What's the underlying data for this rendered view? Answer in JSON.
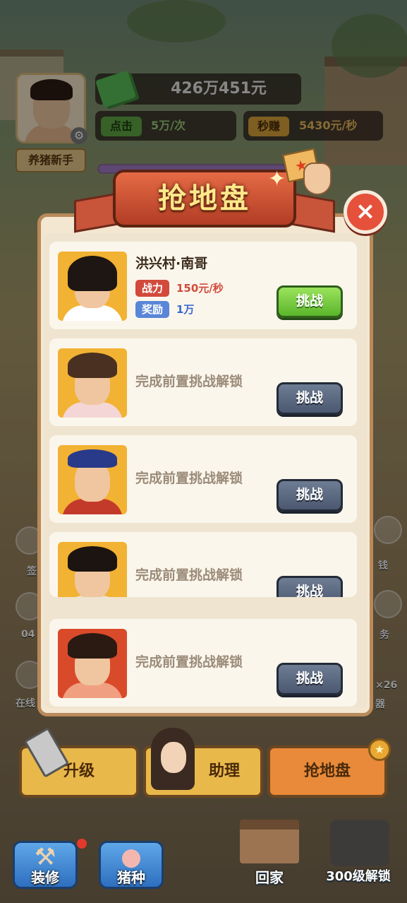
{
  "hud": {
    "money": "426万451元",
    "click_tag": "点击",
    "click_value": "5万/次",
    "earn_tag": "秒赚",
    "earn_value": "5430元/秒",
    "rank": "养猪新手",
    "progress_fraction": 0.9
  },
  "dialog": {
    "title": "抢地盘",
    "close_symbol": "×",
    "opponents": [
      {
        "name": "洪兴村·南哥",
        "power_tag": "战力",
        "power_value": "150元/秒",
        "reward_tag": "奖励",
        "reward_value": "1万",
        "button": "挑战",
        "unlocked": true
      },
      {
        "locked_text": "完成前置挑战解锁",
        "button": "挑战",
        "unlocked": false
      },
      {
        "locked_text": "完成前置挑战解锁",
        "button": "挑战",
        "unlocked": false
      },
      {
        "locked_text": "完成前置挑战解锁",
        "button": "挑战",
        "unlocked": false
      },
      {
        "locked_text": "完成前置挑战解锁",
        "button": "挑战",
        "unlocked": false
      }
    ]
  },
  "bottom": {
    "upgrade_label": "升级",
    "assistant_label": "助理",
    "turf_label": "抢地盘",
    "nav": {
      "decorate": "装修",
      "pig_breed": "猪种",
      "home": "回家",
      "unlock_300": "300级解锁"
    }
  },
  "side": {
    "left_1": "签",
    "left_2": "04",
    "left_3": "在线",
    "right_1": "钱",
    "right_2": "务",
    "right_3": "×26",
    "right_4": "器"
  },
  "colors": {
    "title_text": "#ffe88a",
    "ribbon": "#c8543a",
    "power_tag": "#d24a3c",
    "reward_tag": "#5a86d8",
    "power_value": "#d24a3c",
    "reward_value": "#3a6ad0",
    "button_active": "#5ab52b",
    "button_locked": "#4b5870"
  }
}
